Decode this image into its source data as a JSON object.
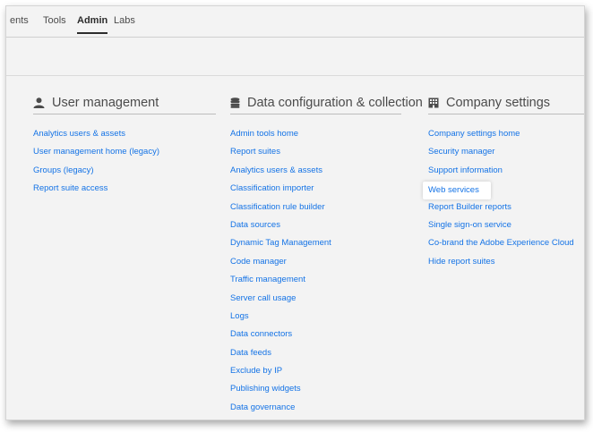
{
  "nav": {
    "tabs": [
      {
        "label": "ents"
      },
      {
        "label": "Tools"
      },
      {
        "label": "Admin"
      },
      {
        "label": "Labs"
      }
    ],
    "active_tab": "Admin"
  },
  "sections": {
    "user_management": {
      "title": "User management",
      "icon": "user-icon",
      "links": [
        "Analytics users & assets",
        "User management home (legacy)",
        "Groups (legacy)",
        "Report suite access"
      ]
    },
    "data_config": {
      "title": "Data configuration & collection",
      "icon": "database-icon",
      "links": [
        "Admin tools home",
        "Report suites",
        "Analytics users & assets",
        "Classification importer",
        "Classification rule builder",
        "Data sources",
        "Dynamic Tag Management",
        "Code manager",
        "Traffic management",
        "Server call usage",
        "Logs",
        "Data connectors",
        "Data feeds",
        "Exclude by IP",
        "Publishing widgets",
        "Data governance"
      ]
    },
    "company_settings": {
      "title": "Company settings",
      "icon": "building-icon",
      "links": [
        "Company settings home",
        "Security manager",
        "Support information",
        "Web services",
        "Report Builder reports",
        "Single sign-on service",
        "Co-brand the Adobe Experience Cloud",
        "Hide report suites"
      ],
      "highlighted": "Web services"
    }
  },
  "colors": {
    "link": "#1473e6",
    "background": "#f3f3f3",
    "text": "#4b4b4b"
  }
}
